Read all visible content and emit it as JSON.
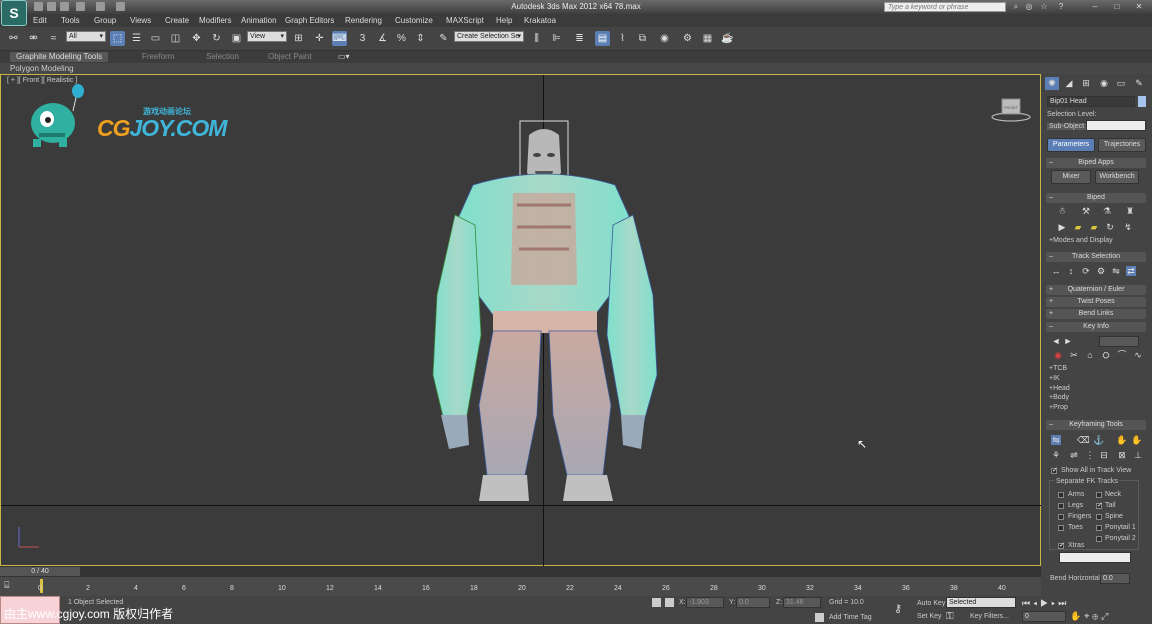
{
  "titlebar": {
    "title": "Autodesk 3ds Max  2012 x64    78.max",
    "search_placeholder": "Type a keyword or phrase",
    "app_icon": "S"
  },
  "menu": [
    "Edit",
    "Tools",
    "Group",
    "Views",
    "Create",
    "Modifiers",
    "Animation",
    "Graph Editors",
    "Rendering",
    "Customize",
    "MAXScript",
    "Help",
    "Krakatoa"
  ],
  "toolbar": {
    "filter": "All",
    "refcoord": "View",
    "selection_set": "Create Selection Se"
  },
  "ribbon": {
    "tabs": [
      "Graphite Modeling Tools",
      "Freeform",
      "Selection",
      "Object Paint"
    ],
    "sub": "Polygon Modeling"
  },
  "viewport": {
    "label": "[ + ][ Front ][ Realistic ]",
    "logo_main": "CG",
    "logo_accent": "JOY.COM",
    "logo_sub": "游戏动画论坛",
    "viewcube_face": "FRONT"
  },
  "command_panel": {
    "object_name": "Bip01 Head",
    "selection_level": "Selection Level:",
    "sub_object": "Sub-Object",
    "tabs": [
      "Parameters",
      "Trajectories"
    ],
    "rollouts": {
      "biped_apps": "Biped Apps",
      "mixer": "Mixer",
      "workbench": "Workbench",
      "biped": "Biped",
      "modes_display": "Modes and Display",
      "track_selection": "Track Selection",
      "quaternion": "Quaternion / Euler",
      "twist_poses": "Twist Poses",
      "bend_links": "Bend Links",
      "key_info": "Key Info",
      "tcb": "TCB",
      "ik": "IK",
      "head": "Head",
      "body": "Body",
      "prop": "Prop",
      "keyframing_tools": "Keyframing Tools",
      "show_all": "Show All in Track View",
      "separate_fk": "Separate FK Tracks",
      "fk_tracks": [
        {
          "label": "Arms",
          "checked": false
        },
        {
          "label": "Neck",
          "checked": false
        },
        {
          "label": "Legs",
          "checked": false
        },
        {
          "label": "Tail",
          "checked": true
        },
        {
          "label": "Fingers",
          "checked": false
        },
        {
          "label": "Spine",
          "checked": false
        },
        {
          "label": "Toes",
          "checked": false
        },
        {
          "label": "Ponytail 1",
          "checked": false
        },
        {
          "label": "Ponytail 2",
          "checked": false
        }
      ],
      "xtras": "Xtras",
      "bend_horizontal": "Bend Horizontal:",
      "bend_value": "0.0"
    }
  },
  "timeline": {
    "frame_display": "0 / 40",
    "ticks": [
      "0",
      "2",
      "4",
      "6",
      "8",
      "10",
      "12",
      "14",
      "16",
      "18",
      "20",
      "22",
      "24",
      "26",
      "28",
      "30",
      "32",
      "34",
      "36",
      "38",
      "40"
    ]
  },
  "status": {
    "selected": "1 Object Selected",
    "x_label": "X:",
    "x_value": "-1.903",
    "y_label": "Y:",
    "y_value": "0.0",
    "z_label": "Z:",
    "z_value": "31.46",
    "grid": "Grid = 10.0",
    "add_time_tag": "Add Time Tag",
    "auto_key": "Auto Key",
    "auto_key_value": "Selected",
    "set_key": "Set Key",
    "key_filters": "Key Filters...",
    "frame": "0"
  },
  "watermark": "由主www.cgjoy.com 版权归作者",
  "colors": {
    "accent": "#5b7fb5",
    "viewport_border": "#c9b642",
    "logo_orange": "#f0a020",
    "logo_blue": "#3fb5d9",
    "mesh_teal": "#8fd9c8"
  }
}
